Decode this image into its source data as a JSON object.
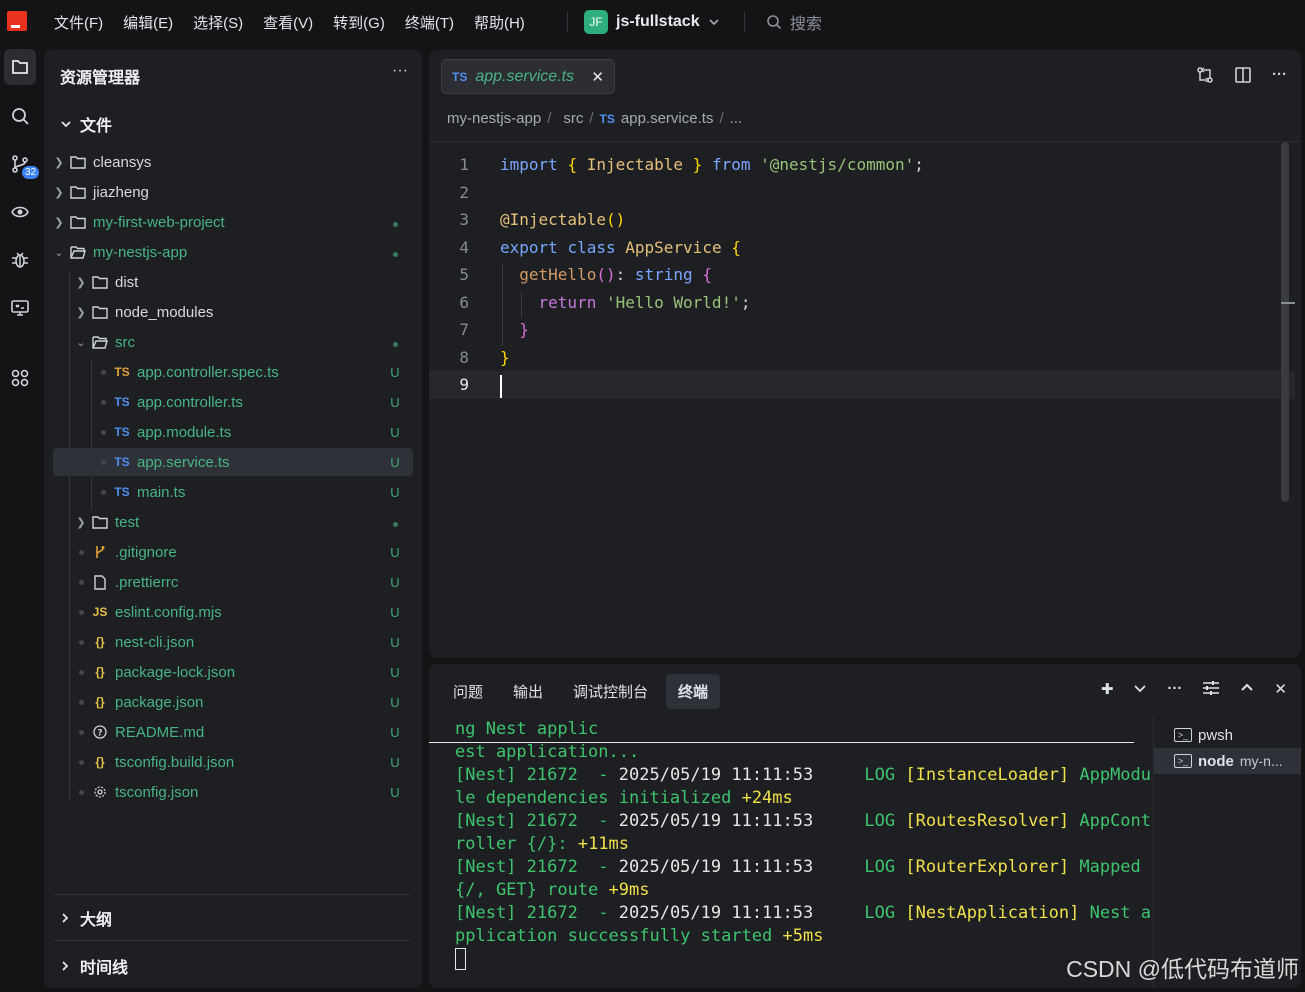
{
  "menu": [
    "文件(F)",
    "编辑(E)",
    "选择(S)",
    "查看(V)",
    "转到(G)",
    "终端(T)",
    "帮助(H)"
  ],
  "project": {
    "badge": "JF",
    "name": "js-fullstack"
  },
  "search": {
    "label": "搜索"
  },
  "activity": {
    "scm_badge": "32"
  },
  "explorer": {
    "title": "资源管理器",
    "more": "···",
    "files_header": "文件",
    "rows": [
      {
        "label": "cleansys",
        "status": ""
      },
      {
        "label": "jiazheng",
        "status": ""
      },
      {
        "label": "my-first-web-project",
        "status": "●"
      },
      {
        "label": "my-nestjs-app",
        "status": "●"
      },
      {
        "label": "dist",
        "status": ""
      },
      {
        "label": "node_modules",
        "status": ""
      },
      {
        "label": "src",
        "status": "●"
      },
      {
        "label": "app.controller.spec.ts",
        "status": "U",
        "badge": "TS"
      },
      {
        "label": "app.controller.ts",
        "status": "U",
        "badge": "TS"
      },
      {
        "label": "app.module.ts",
        "status": "U",
        "badge": "TS"
      },
      {
        "label": "app.service.ts",
        "status": "U",
        "badge": "TS"
      },
      {
        "label": "main.ts",
        "status": "U",
        "badge": "TS"
      },
      {
        "label": "test",
        "status": "●"
      },
      {
        "label": ".gitignore",
        "status": "U"
      },
      {
        "label": ".prettierrc",
        "status": "U"
      },
      {
        "label": "eslint.config.mjs",
        "status": "U",
        "badge": "JS"
      },
      {
        "label": "nest-cli.json",
        "status": "U",
        "badge": "{}"
      },
      {
        "label": "package-lock.json",
        "status": "U",
        "badge": "{}"
      },
      {
        "label": "package.json",
        "status": "U",
        "badge": "{}"
      },
      {
        "label": "README.md",
        "status": "U"
      },
      {
        "label": "tsconfig.build.json",
        "status": "U",
        "badge": "{}"
      },
      {
        "label": "tsconfig.json",
        "status": "U"
      }
    ],
    "outline": "大纲",
    "timeline": "时间线"
  },
  "editor": {
    "tab": {
      "badge": "TS",
      "label": "app.service.ts",
      "close": "✕"
    },
    "breadcrumb": {
      "root": "my-nestjs-app",
      "folder": "src",
      "badge": "TS",
      "file": "app.service.ts",
      "more": "..."
    },
    "line_numbers": [
      "1",
      "2",
      "3",
      "4",
      "5",
      "6",
      "7",
      "8",
      "9"
    ],
    "code": {
      "l1_kw": "import",
      "l1_open": "{",
      "l1_id": " Injectable ",
      "l1_close": "}",
      "l1_from": "from",
      "l1_str": "'@nestjs/common'",
      "l1_end": ";",
      "l3_dec": "@Injectable",
      "l3_paren": "()",
      "l4_kw1": "export",
      "l4_kw2": "class",
      "l4_id": "AppService",
      "l4_brace": "{",
      "l5_fn": "getHello",
      "l5_paren": "()",
      "l5_colon": ":",
      "l5_type": "string",
      "l5_brace": "{",
      "l6_kw": "return",
      "l6_str": "'Hello World!'",
      "l6_end": ";",
      "l7_brace": "}",
      "l8_brace": "}"
    }
  },
  "panel": {
    "tabs": [
      "问题",
      "输出",
      "调试控制台",
      "终端"
    ],
    "terminal": [
      {
        "segments": [
          {
            "c": "g",
            "t": "ng Nest applic"
          }
        ]
      },
      {
        "segments": [
          {
            "c": "g",
            "t": "est application..."
          }
        ]
      },
      {
        "segments": [
          {
            "c": "g",
            "t": "[Nest] 21672  - "
          },
          {
            "c": "w",
            "t": "2025/05/19 11:11:53"
          },
          {
            "c": "g",
            "t": "     LOG "
          },
          {
            "c": "y",
            "t": "[InstanceLoader]"
          },
          {
            "c": "g",
            "t": " AppModu"
          }
        ]
      },
      {
        "segments": [
          {
            "c": "g",
            "t": "le dependencies initialized "
          },
          {
            "c": "y",
            "t": "+24ms"
          }
        ]
      },
      {
        "segments": [
          {
            "c": "g",
            "t": "[Nest] 21672  - "
          },
          {
            "c": "w",
            "t": "2025/05/19 11:11:53"
          },
          {
            "c": "g",
            "t": "     LOG "
          },
          {
            "c": "y",
            "t": "[RoutesResolver]"
          },
          {
            "c": "g",
            "t": " AppCont"
          }
        ]
      },
      {
        "segments": [
          {
            "c": "g",
            "t": "roller {/}: "
          },
          {
            "c": "y",
            "t": "+11ms"
          }
        ]
      },
      {
        "segments": [
          {
            "c": "g",
            "t": "[Nest] 21672  - "
          },
          {
            "c": "w",
            "t": "2025/05/19 11:11:53"
          },
          {
            "c": "g",
            "t": "     LOG "
          },
          {
            "c": "y",
            "t": "[RouterExplorer]"
          },
          {
            "c": "g",
            "t": " Mapped"
          }
        ]
      },
      {
        "segments": [
          {
            "c": "g",
            "t": "{/, GET} route "
          },
          {
            "c": "y",
            "t": "+9ms"
          }
        ]
      },
      {
        "segments": [
          {
            "c": "g",
            "t": "[Nest] 21672  - "
          },
          {
            "c": "w",
            "t": "2025/05/19 11:11:53"
          },
          {
            "c": "g",
            "t": "     LOG "
          },
          {
            "c": "y",
            "t": "[NestApplication]"
          },
          {
            "c": "g",
            "t": " Nest a"
          }
        ]
      },
      {
        "segments": [
          {
            "c": "g",
            "t": "pplication successfully started "
          },
          {
            "c": "y",
            "t": "+5ms"
          }
        ]
      }
    ],
    "sessions": [
      {
        "name": "pwsh",
        "detail": ""
      },
      {
        "name": "node",
        "detail": "my-n..."
      }
    ]
  },
  "watermark": "CSDN @低代码布道师"
}
